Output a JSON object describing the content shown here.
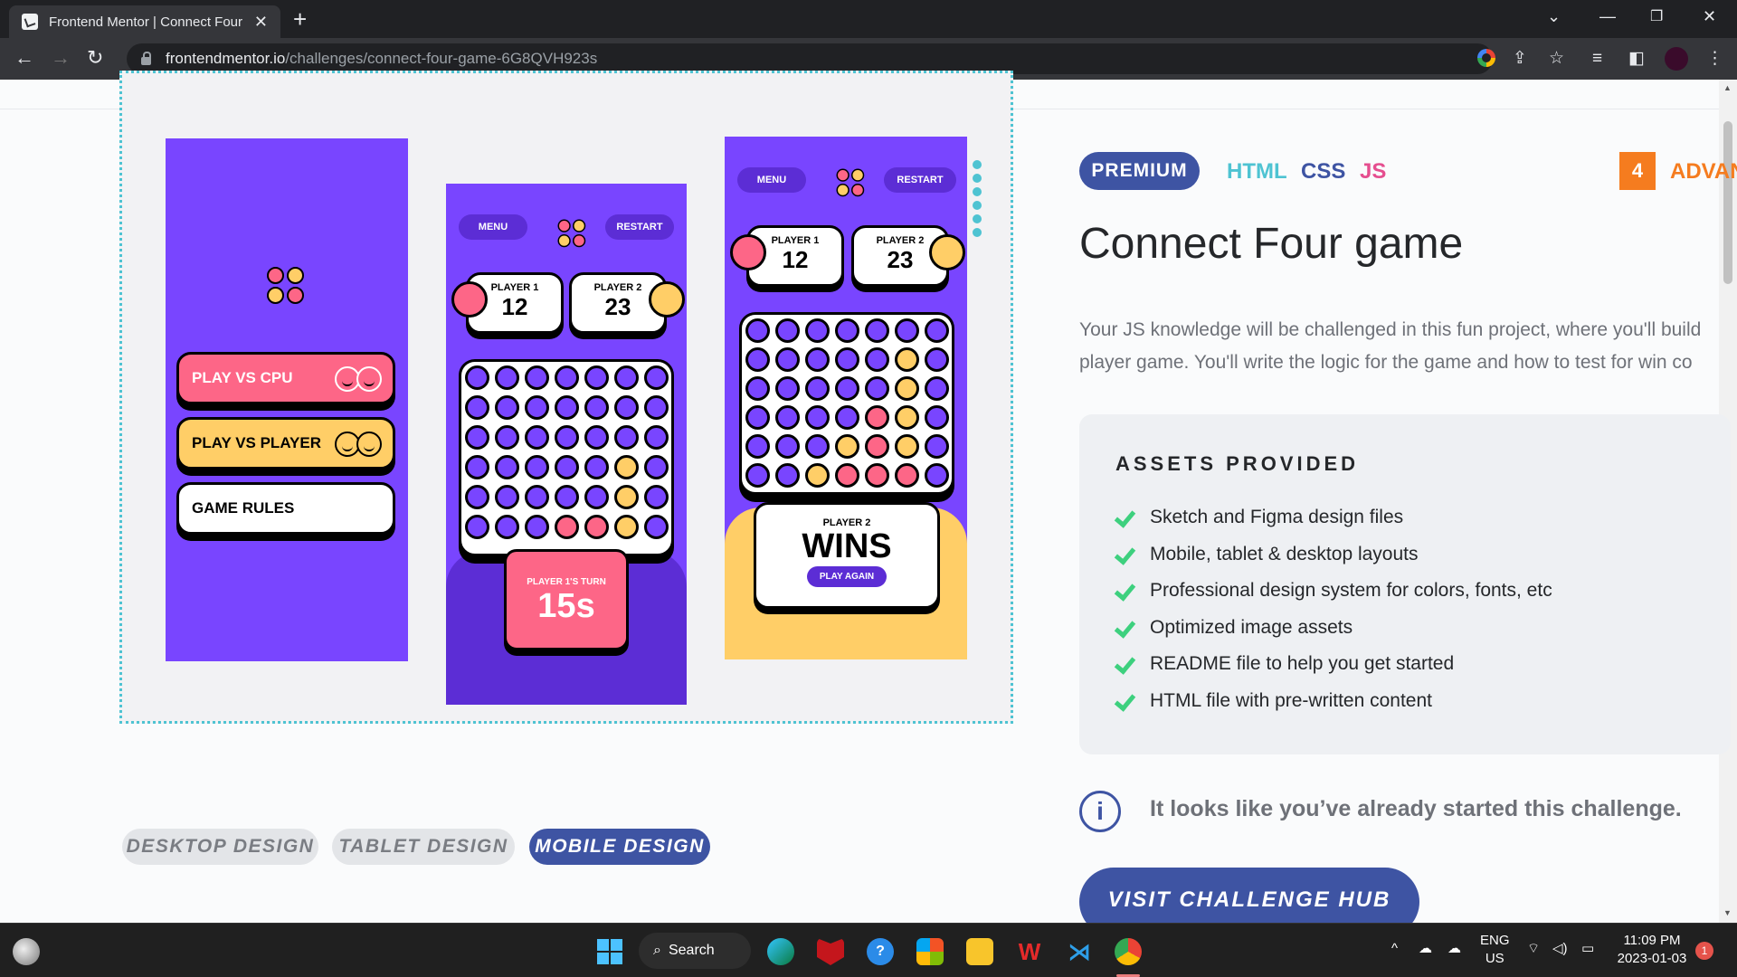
{
  "browser": {
    "tab_title": "Frontend Mentor | Connect Four",
    "url_host": "frontendmentor.io",
    "url_path": "/challenges/connect-four-game-6G8QVH923s"
  },
  "preview": {
    "menu_label": "MENU",
    "restart_label": "RESTART",
    "play_vs_cpu": "PLAY VS CPU",
    "play_vs_player": "PLAY VS PLAYER",
    "game_rules": "GAME RULES",
    "player1": "PLAYER 1",
    "player2": "PLAYER 2",
    "score1": "12",
    "score2": "23",
    "turn_label": "PLAYER 1'S TURN",
    "turn_time": "15s",
    "winner_label": "PLAYER 2",
    "wins": "WINS",
    "play_again": "PLAY AGAIN",
    "colors": {
      "purple": "#7945ff",
      "dark_purple": "#5c2dd5",
      "red": "#fd6687",
      "yellow": "#ffce67"
    }
  },
  "design_tabs": [
    "DESKTOP DESIGN",
    "TABLET DESIGN",
    "MOBILE DESIGN"
  ],
  "challenge": {
    "badge": "PREMIUM",
    "languages": [
      "HTML",
      "CSS",
      "JS"
    ],
    "difficulty_num": "4",
    "difficulty_label": "ADVANCED",
    "title": "Connect Four game",
    "desc_line1": "Your JS knowledge will be challenged in this fun project, where you'll build",
    "desc_line2": "player game. You'll write the logic for the game and how to test for win co"
  },
  "assets": {
    "title": "ASSETS PROVIDED",
    "items": [
      "Sketch and Figma design files",
      "Mobile, tablet & desktop layouts",
      "Professional design system for colors, fonts, etc",
      "Optimized image assets",
      "README file to help you get started",
      "HTML file with pre-written content"
    ]
  },
  "notice": "It looks like you’ve already started this challenge.",
  "hub_button": "VISIT CHALLENGE HUB",
  "taskbar": {
    "search": "Search",
    "lang": "ENG",
    "region": "US",
    "time": "11:09 PM",
    "date": "2023-01-03",
    "notif_count": "1"
  }
}
